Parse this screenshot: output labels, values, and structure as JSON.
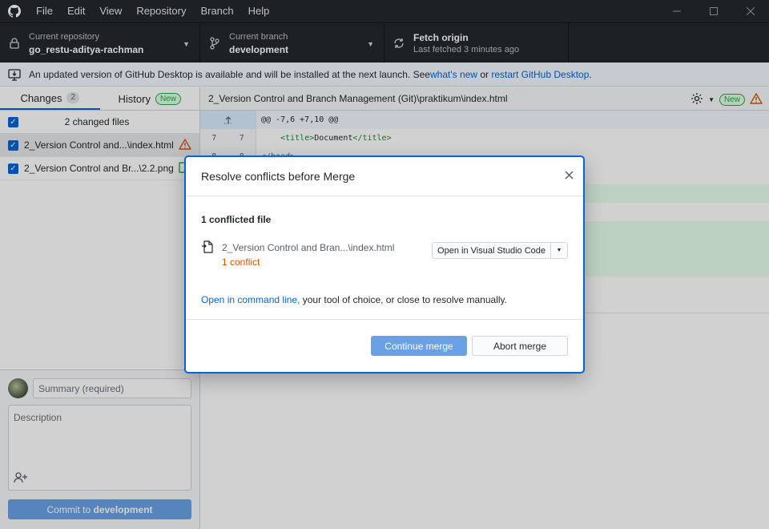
{
  "menu": [
    "File",
    "Edit",
    "View",
    "Repository",
    "Branch",
    "Help"
  ],
  "toolbar": {
    "repo_label": "Current repository",
    "repo_value": "go_restu-aditya-rachman",
    "branch_label": "Current branch",
    "branch_value": "development",
    "fetch_label": "Fetch origin",
    "fetch_sub": "Last fetched 3 minutes ago"
  },
  "banner": {
    "text": "An updated version of GitHub Desktop is available and will be installed at the next launch. See ",
    "link1": "what's new",
    "mid": " or ",
    "link2": "restart GitHub Desktop",
    "end": "."
  },
  "sidebar": {
    "tabs": [
      {
        "label": "Changes",
        "badge": "2"
      },
      {
        "label": "History",
        "badge": "New"
      }
    ],
    "changes_title": "2 changed files",
    "files": [
      {
        "name": "2_Version Control and...\\index.html"
      },
      {
        "name": "2_Version Control and Br...\\2.2.png"
      }
    ],
    "summary_placeholder": "Summary (required)",
    "description_placeholder": "Description",
    "commit_prefix": "Commit to ",
    "commit_branch": "development"
  },
  "main": {
    "path": "2_Version Control and Branch Management (Git)\\praktikum\\index.html",
    "new_badge": "New",
    "diff": {
      "hunk": "@@ -7,6 +7,10 @@",
      "line_old": "7",
      "line_new": "7",
      "line_open_tag": "<title>",
      "line_text": "Document",
      "line_close_tag": "</title>",
      "line2_old": "8",
      "line2_new": "8",
      "line2_code": "</head>"
    }
  },
  "modal": {
    "title": "Resolve conflicts before Merge",
    "conflicted_count": "1 conflicted file",
    "file_name": "2_Version Control and Bran...\\index.html",
    "file_conflicts": "1 conflict",
    "open_button": "Open in Visual Studio Code",
    "manual_link": "Open in command line,",
    "manual_text": " your tool of choice, or close to resolve manually.",
    "continue_button": "Continue merge",
    "abort_button": "Abort merge"
  }
}
